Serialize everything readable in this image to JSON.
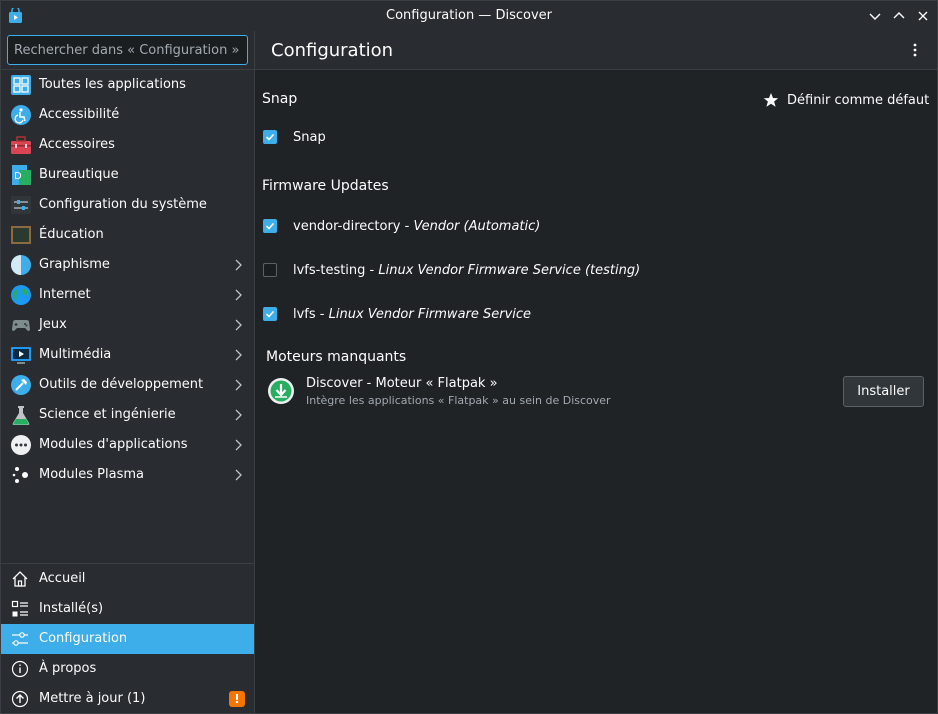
{
  "window": {
    "title": "Configuration — Discover",
    "controls": [
      "minimize",
      "maximize",
      "close"
    ]
  },
  "search": {
    "placeholder": "Rechercher dans « Configuration »…"
  },
  "categories": [
    {
      "label": "Toutes les applications",
      "icon": "grid-icon",
      "has_submenu": false
    },
    {
      "label": "Accessibilité",
      "icon": "accessibility-icon",
      "has_submenu": false
    },
    {
      "label": "Accessoires",
      "icon": "toolbox-icon",
      "has_submenu": false
    },
    {
      "label": "Bureautique",
      "icon": "office-icon",
      "has_submenu": false
    },
    {
      "label": "Configuration du système",
      "icon": "system-settings-icon",
      "has_submenu": false
    },
    {
      "label": "Éducation",
      "icon": "blackboard-icon",
      "has_submenu": false
    },
    {
      "label": "Graphisme",
      "icon": "graphics-icon",
      "has_submenu": true
    },
    {
      "label": "Internet",
      "icon": "globe-icon",
      "has_submenu": true
    },
    {
      "label": "Jeux",
      "icon": "gamepad-icon",
      "has_submenu": true
    },
    {
      "label": "Multimédia",
      "icon": "monitor-play-icon",
      "has_submenu": true
    },
    {
      "label": "Outils de développement",
      "icon": "hammer-icon",
      "has_submenu": true
    },
    {
      "label": "Science et ingénierie",
      "icon": "flask-icon",
      "has_submenu": true
    },
    {
      "label": "Modules d'applications",
      "icon": "more-dots-icon",
      "has_submenu": true
    },
    {
      "label": "Modules Plasma",
      "icon": "plasma-icon",
      "has_submenu": true
    }
  ],
  "nav": [
    {
      "label": "Accueil",
      "icon": "home-icon",
      "active": false
    },
    {
      "label": "Installé(s)",
      "icon": "installed-list-icon",
      "active": false
    },
    {
      "label": "Configuration",
      "icon": "settings-sliders-icon",
      "active": true
    },
    {
      "label": "À propos",
      "icon": "info-icon",
      "active": false
    },
    {
      "label": "Mettre à jour (1)",
      "icon": "update-icon",
      "active": false,
      "badge": "!"
    }
  ],
  "main": {
    "title": "Configuration",
    "snap_section": {
      "title": "Snap",
      "default_label": "Définir comme défaut",
      "sources": [
        {
          "name": "Snap",
          "desc": "",
          "checked": true
        }
      ]
    },
    "firmware_section": {
      "title": "Firmware Updates",
      "sources": [
        {
          "name": "vendor-directory",
          "separator": " - ",
          "desc": "Vendor (Automatic)",
          "checked": true
        },
        {
          "name": "lvfs-testing",
          "separator": " - ",
          "desc": "Linux Vendor Firmware Service (testing)",
          "checked": false
        },
        {
          "name": "lvfs",
          "separator": " - ",
          "desc": "Linux Vendor Firmware Service",
          "checked": true
        }
      ]
    },
    "missing_section": {
      "title": "Moteurs manquants",
      "backend": {
        "name": "Discover - Moteur « Flatpak »",
        "desc": "Intègre les applications « Flatpak » au sein de Discover",
        "button": "Installer"
      }
    }
  },
  "colors": {
    "accent": "#3daee9",
    "window_bg": "#202326",
    "panel_bg": "#292c30",
    "badge": "#f67400"
  }
}
